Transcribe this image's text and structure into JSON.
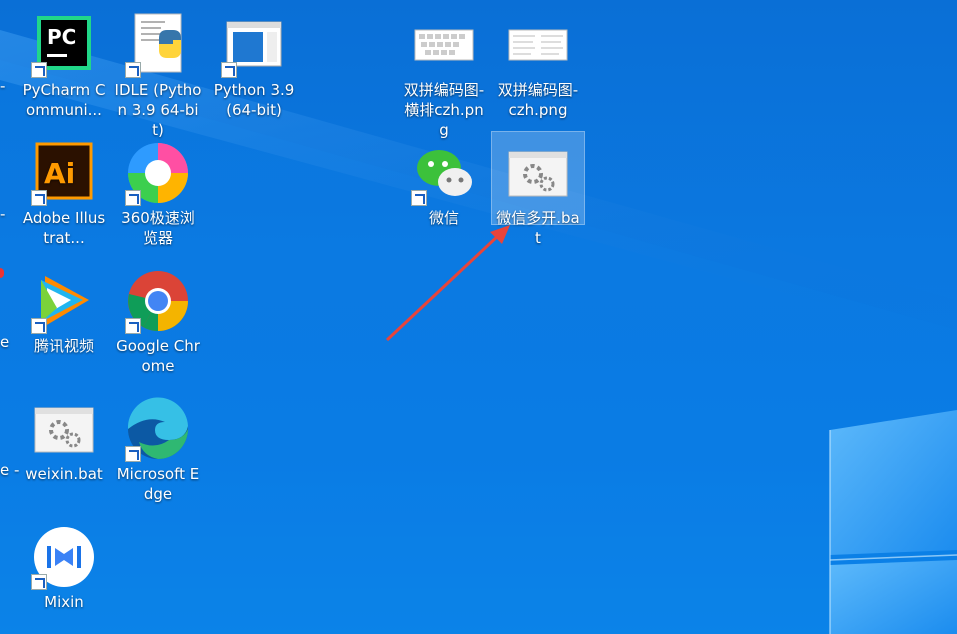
{
  "desktop": {
    "icons": [
      {
        "id": "pycharm",
        "label": "PyCharm Communi...",
        "icon": "pycharm-icon"
      },
      {
        "id": "idle",
        "label": "IDLE (Python 3.9 64-bit)",
        "icon": "python-idle-icon"
      },
      {
        "id": "python39",
        "label": "Python 3.9 (64-bit)",
        "icon": "python-window-icon"
      },
      {
        "id": "png1",
        "label": "双拼编码图-横排czh.png",
        "icon": "image-file-icon"
      },
      {
        "id": "png2",
        "label": "双拼编码图-czh.png",
        "icon": "image-file-icon"
      },
      {
        "id": "illustrator",
        "label": "Adobe Illustrat...",
        "icon": "illustrator-icon"
      },
      {
        "id": "b360",
        "label": "360极速浏览器",
        "icon": "browser-360-icon"
      },
      {
        "id": "wechat",
        "label": "微信",
        "icon": "wechat-icon"
      },
      {
        "id": "wechatbat",
        "label": "微信多开.bat",
        "icon": "batch-file-icon"
      },
      {
        "id": "tencentvideo",
        "label": "腾讯视频",
        "icon": "tencent-video-icon"
      },
      {
        "id": "chrome",
        "label": "Google Chrome",
        "icon": "chrome-icon"
      },
      {
        "id": "weixinbat",
        "label": "weixin.bat",
        "icon": "batch-file-icon"
      },
      {
        "id": "edge",
        "label": "Microsoft Edge",
        "icon": "edge-icon"
      },
      {
        "id": "mixin",
        "label": "Mixin",
        "icon": "mixin-icon"
      }
    ],
    "left_edge_fragments": [
      "-",
      "-",
      "e",
      "e -"
    ],
    "accent_colors": {
      "wallpaper": "#0b78e0",
      "arrow": "#e8443a",
      "selection": "#ffffff"
    }
  }
}
